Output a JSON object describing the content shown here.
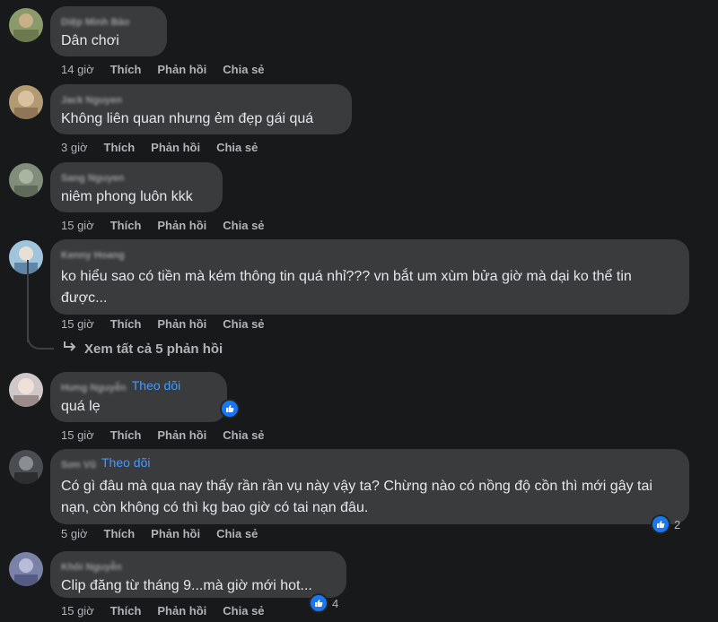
{
  "comments": [
    {
      "name": "Diệp Minh Bảo",
      "text": "Dân chơi",
      "time": "14 giờ",
      "like": "Thích",
      "reply": "Phản hồi",
      "share": "Chia sẻ"
    },
    {
      "name": "Jack Nguyen",
      "text": "Không liên quan nhưng ẻm đẹp gái quá",
      "time": "3 giờ",
      "like": "Thích",
      "reply": "Phản hồi",
      "share": "Chia sẻ"
    },
    {
      "name": "Sang Nguyen",
      "text": "niêm phong luôn kkk",
      "time": "15 giờ",
      "like": "Thích",
      "reply": "Phản hồi",
      "share": "Chia sẻ"
    },
    {
      "name": "Kenny Hoang",
      "text": "ko hiểu sao có tiền mà kém thông tin quá nhỉ??? vn bắt um xùm bửa giờ mà dại ko thể tin được...",
      "time": "15 giờ",
      "like": "Thích",
      "reply": "Phản hồi",
      "share": "Chia sẻ"
    },
    {
      "name": "Hưng Nguyễn",
      "follow": "Theo dõi",
      "text": "quá lẹ",
      "time": "15 giờ",
      "like": "Thích",
      "reply": "Phản hồi",
      "share": "Chia sẻ"
    },
    {
      "name": "Sơn Vũ",
      "follow": "Theo dõi",
      "text": "Có gì đâu mà qua nay thấy rần rần vụ này vậy ta? Chừng nào có nồng độ cồn thì mới gây tai nạn, còn không có thì kg bao giờ có tai nạn đâu.",
      "time": "5 giờ",
      "like": "Thích",
      "reply": "Phản hồi",
      "share": "Chia sẻ",
      "reactions": "2"
    },
    {
      "name": "Khôi Nguyễn",
      "text": "Clip đăng từ tháng 9...mà giờ mới hot...",
      "time": "15 giờ",
      "like": "Thích",
      "reply": "Phản hồi",
      "share": "Chia sẻ",
      "reactions": "4"
    }
  ],
  "view_replies": "Xem tất cả 5 phản hồi",
  "icons": {
    "like": "thumbs-up-icon",
    "reply_arrow": "reply-arrow-icon"
  },
  "colors": {
    "background": "#18191a",
    "bubble": "#3a3b3c",
    "follow": "#4599ff",
    "like_badge": "#1877f2"
  }
}
